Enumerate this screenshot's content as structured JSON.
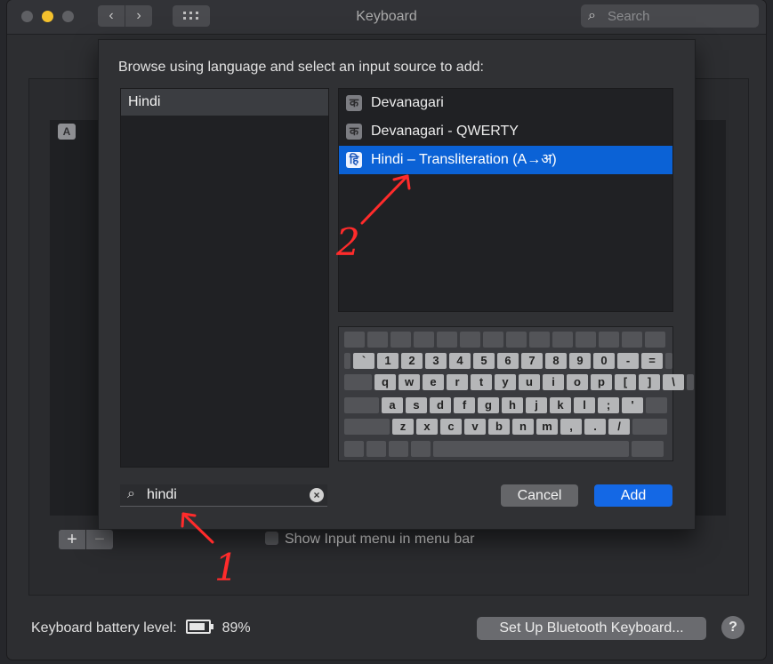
{
  "window": {
    "title": "Keyboard",
    "search_placeholder": "Search"
  },
  "dialog": {
    "heading": "Browse using language and select an input source to add:",
    "languages": [
      "Hindi"
    ],
    "sources": [
      {
        "label": "Devanagari",
        "icon": "क",
        "selected": false
      },
      {
        "label": "Devanagari - QWERTY",
        "icon": "क",
        "selected": false
      },
      {
        "label": "Hindi – Transliteration (A→अ)",
        "icon": "हि",
        "selected": true
      }
    ],
    "keyboard_rows": [
      [
        "`",
        "1",
        "2",
        "3",
        "4",
        "5",
        "6",
        "7",
        "8",
        "9",
        "0",
        "-",
        "="
      ],
      [
        "q",
        "w",
        "e",
        "r",
        "t",
        "y",
        "u",
        "i",
        "o",
        "p",
        "[",
        "]",
        "\\"
      ],
      [
        "a",
        "s",
        "d",
        "f",
        "g",
        "h",
        "j",
        "k",
        "l",
        ";",
        "'"
      ],
      [
        "z",
        "x",
        "c",
        "v",
        "b",
        "n",
        "m",
        ",",
        ".",
        "/"
      ]
    ],
    "search": {
      "value": "hindi"
    },
    "cancel_label": "Cancel",
    "add_label": "Add"
  },
  "background": {
    "partial_icon": "A",
    "plus_label": "+",
    "minus_label": "−",
    "show_input_menu_label": "Show Input menu in menu bar",
    "battery_label": "Keyboard battery level:",
    "battery_percent": "89%",
    "bluetooth_button_label": "Set Up Bluetooth Keyboard...",
    "help_label": "?"
  },
  "annotations": {
    "arrow1_label": "1",
    "arrow2_label": "2"
  },
  "colors": {
    "accent": "#0B62D6",
    "annotation": "#FF2B2B"
  }
}
